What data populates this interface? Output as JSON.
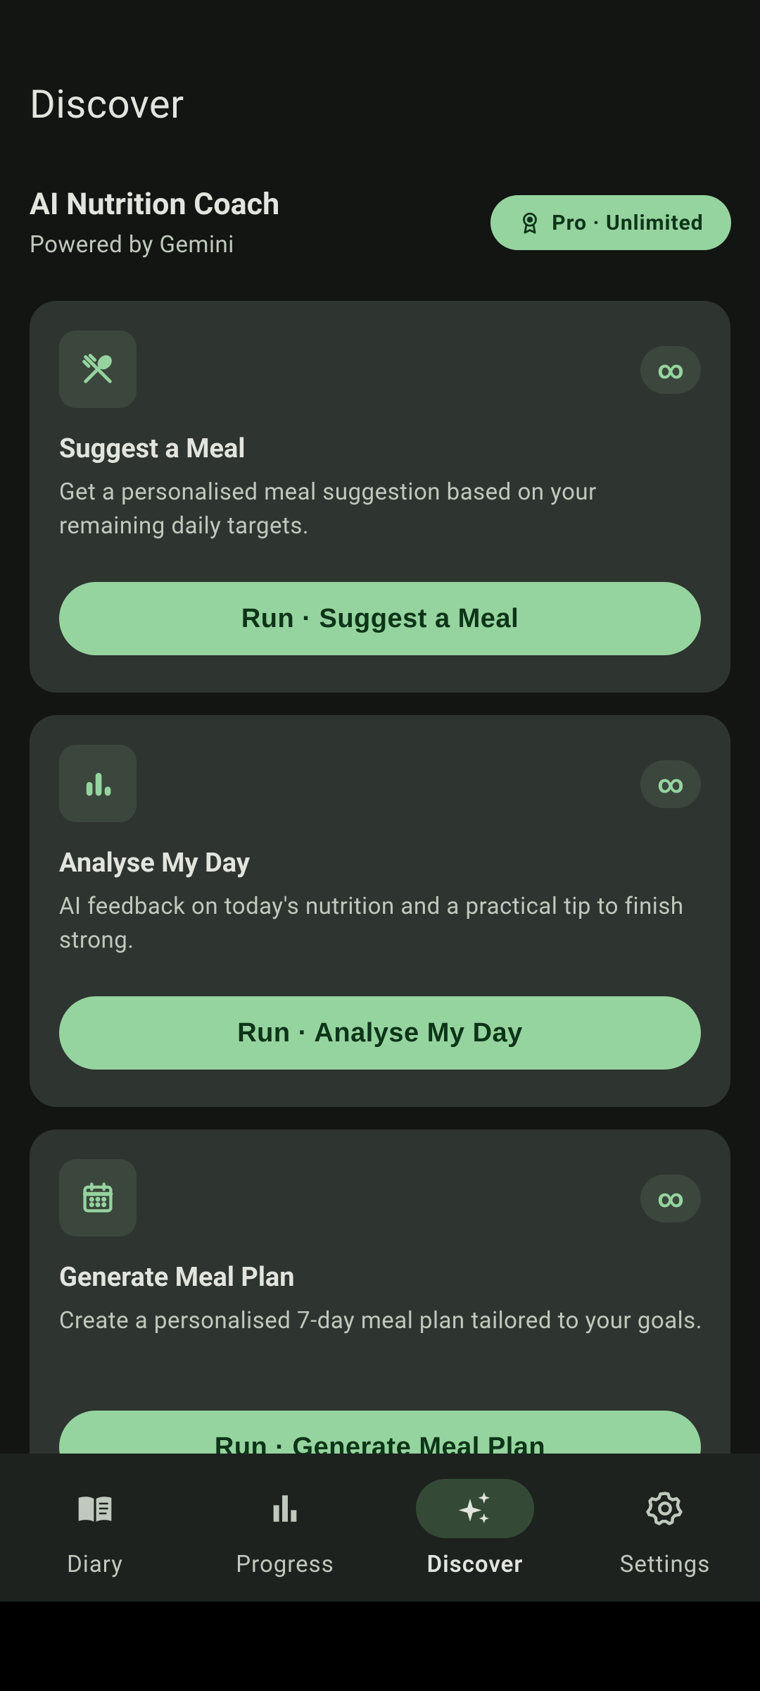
{
  "page": {
    "title": "Discover"
  },
  "section": {
    "title": "AI Nutrition Coach",
    "subtitle": "Powered by Gemini",
    "badge": {
      "label": "Pro · Unlimited",
      "icon": "award-ribbon-icon"
    }
  },
  "cards": [
    {
      "icon": "fork-spoon-icon",
      "usage": "∞",
      "title": "Suggest a Meal",
      "description": "Get a personalised meal suggestion based on your remaining daily targets.",
      "button": "Run · Suggest a Meal"
    },
    {
      "icon": "bar-chart-icon",
      "usage": "∞",
      "title": "Analyse My Day",
      "description": "AI feedback on today's nutrition and a practical tip to finish strong.",
      "button": "Run · Analyse My Day"
    },
    {
      "icon": "calendar-icon",
      "usage": "∞",
      "title": "Generate Meal Plan",
      "description": "Create a personalised 7-day meal plan tailored to your goals.",
      "button": "Run · Generate Meal Plan"
    }
  ],
  "nav": {
    "items": [
      {
        "label": "Diary",
        "icon": "book-icon",
        "active": false
      },
      {
        "label": "Progress",
        "icon": "bar-chart-icon",
        "active": false
      },
      {
        "label": "Discover",
        "icon": "sparkles-icon",
        "active": true
      },
      {
        "label": "Settings",
        "icon": "gear-icon",
        "active": false
      }
    ]
  },
  "colors": {
    "background": "#121512",
    "card": "#2e342f",
    "accent": "#96d49f",
    "on_accent": "#0d3418",
    "text_primary": "#e2e5de",
    "text_secondary": "#c0c9bd"
  }
}
